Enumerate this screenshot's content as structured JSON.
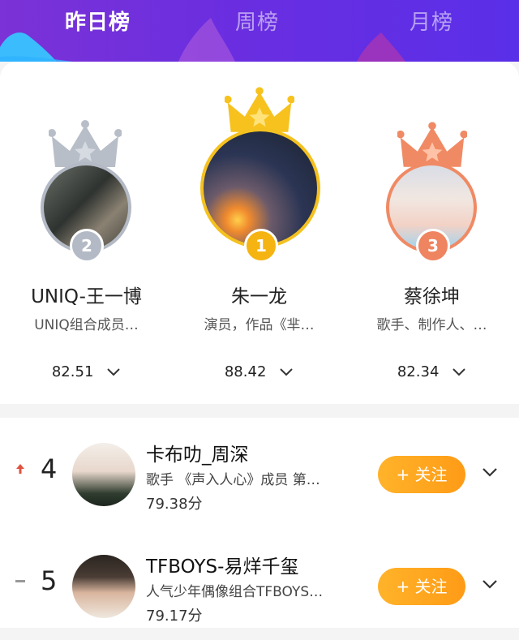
{
  "tabs": [
    {
      "label": "昨日榜",
      "active": true
    },
    {
      "label": "周榜",
      "active": false
    },
    {
      "label": "月榜",
      "active": false
    }
  ],
  "colors": {
    "header_start": "#7b32d6",
    "header_end": "#5a2fe8",
    "gold": "#f7c21e",
    "silver": "#b4bac4",
    "bronze": "#f08a64",
    "follow": "#ff9f1a",
    "up_arrow": "#e0523f"
  },
  "top3": [
    {
      "rank": "2",
      "name": "UNIQ-王一博",
      "desc": "UNIQ组合成员…",
      "score": "82.51",
      "medal": "silver"
    },
    {
      "rank": "1",
      "name": "朱一龙",
      "desc": "演员，作品《芈…",
      "score": "88.42",
      "medal": "gold"
    },
    {
      "rank": "3",
      "name": "蔡徐坤",
      "desc": "歌手、制作人、…",
      "score": "82.34",
      "medal": "bronze"
    }
  ],
  "list": [
    {
      "rank": "4",
      "trend": "up",
      "name": "卡布叻_周深",
      "desc": "歌手 《声入人心》成员 第…",
      "score": "79.38分",
      "follow_label": "+ 关注"
    },
    {
      "rank": "5",
      "trend": "same",
      "name": "TFBOYS-易烊千玺",
      "desc": "人气少年偶像组合TFBOYS…",
      "score": "79.17分",
      "follow_label": "+ 关注"
    }
  ]
}
